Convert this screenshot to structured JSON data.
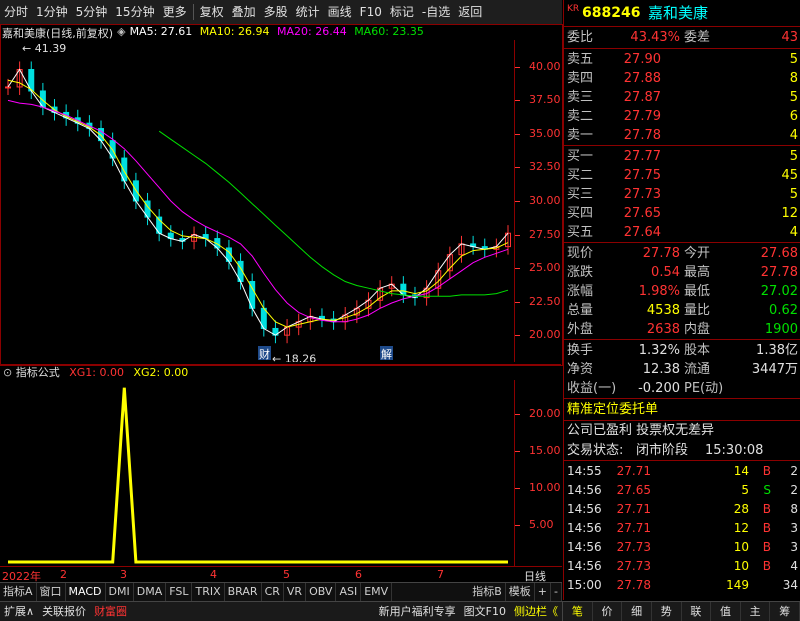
{
  "toolbar": {
    "items": [
      "分时",
      "1分钟",
      "5分钟",
      "15分钟",
      "更多",
      "复权",
      "叠加",
      "多股",
      "统计",
      "画线",
      "F10",
      "标记",
      "-自选",
      "返回"
    ]
  },
  "stock": {
    "market": "KR",
    "code": "688246",
    "name": "嘉和美康"
  },
  "main_chart": {
    "title": "嘉和美康(日线,前复权)",
    "ma": [
      {
        "label": "MA5:",
        "value": "27.61",
        "color": "#ffffff"
      },
      {
        "label": "MA10:",
        "value": "26.94",
        "color": "#ffff00"
      },
      {
        "label": "MA20:",
        "value": "26.44",
        "color": "#ff00ff"
      },
      {
        "label": "MA60:",
        "value": "23.35",
        "color": "#00e000"
      }
    ],
    "price_ticks": [
      "40.00",
      "37.50",
      "35.00",
      "32.50",
      "30.00",
      "27.50",
      "25.00",
      "22.50",
      "20.00"
    ],
    "high_label": "41.39",
    "low_label": "18.26",
    "marker_cai": "财",
    "marker_jie": "解"
  },
  "indicator": {
    "title": "指标公式",
    "xg1_label": "XG1:",
    "xg1_value": "0.00",
    "xg2_label": "XG2:",
    "xg2_value": "0.00",
    "ticks": [
      "20.00",
      "15.00",
      "10.00",
      "5.00"
    ]
  },
  "time_axis": {
    "labels": [
      "2022年",
      "2",
      "3",
      "4",
      "5",
      "6",
      "7"
    ],
    "right_label": "日线"
  },
  "chart_data": {
    "type": "candlestick",
    "ylim": [
      18,
      42
    ],
    "x_months": [
      "2022年",
      "2",
      "3",
      "4",
      "5",
      "6",
      "7"
    ],
    "ma5": [
      38.5,
      39.8,
      38.2,
      37.0,
      36.6,
      36.2,
      35.8,
      35.4,
      34.5,
      33.2,
      31.5,
      30.0,
      28.8,
      27.6,
      27.2,
      27.0,
      27.5,
      27.2,
      26.5,
      25.5,
      24.0,
      22.0,
      20.5,
      20.0,
      20.6,
      21.0,
      21.4,
      21.2,
      21.0,
      21.5,
      22.0,
      22.6,
      23.5,
      23.8,
      23.0,
      22.8,
      23.5,
      24.8,
      26.0,
      26.8,
      26.6,
      26.4,
      26.6,
      27.6
    ],
    "ma10": [
      39.0,
      38.8,
      38.3,
      37.5,
      36.8,
      36.3,
      35.9,
      35.5,
      34.9,
      33.8,
      32.2,
      30.8,
      29.6,
      28.6,
      27.8,
      27.4,
      27.3,
      27.2,
      26.8,
      26.2,
      25.0,
      23.5,
      22.0,
      21.0,
      20.6,
      20.8,
      21.0,
      21.2,
      21.1,
      21.3,
      21.6,
      22.1,
      22.8,
      23.3,
      23.3,
      23.1,
      23.3,
      24.0,
      25.0,
      25.9,
      26.3,
      26.4,
      26.5,
      26.9
    ],
    "ma20": [
      37.5,
      37.3,
      37.2,
      37.0,
      36.7,
      36.4,
      36.0,
      35.6,
      35.2,
      34.6,
      33.9,
      33.0,
      32.0,
      31.0,
      30.0,
      29.2,
      28.6,
      28.1,
      27.7,
      27.3,
      26.8,
      25.9,
      24.6,
      23.4,
      22.4,
      21.7,
      21.3,
      21.1,
      21.0,
      21.0,
      21.2,
      21.5,
      22.0,
      22.4,
      22.7,
      22.9,
      23.1,
      23.6,
      24.2,
      24.8,
      25.4,
      25.8,
      26.1,
      26.4
    ],
    "ma60": [
      null,
      null,
      null,
      null,
      null,
      null,
      null,
      null,
      null,
      null,
      null,
      null,
      null,
      35.2,
      34.6,
      34.0,
      33.4,
      32.8,
      32.1,
      31.4,
      30.6,
      29.8,
      29.0,
      28.2,
      27.4,
      26.6,
      25.8,
      25.1,
      24.5,
      24.0,
      23.7,
      23.5,
      23.3,
      23.1,
      23.0,
      22.9,
      22.9,
      22.9,
      22.9,
      23.0,
      23.0,
      23.0,
      23.1,
      23.35
    ],
    "xg1": [
      0,
      0,
      0,
      0,
      0,
      0,
      0,
      0,
      0,
      0,
      23.5,
      0,
      0,
      0,
      0,
      0,
      0,
      0,
      0,
      0,
      0,
      0,
      0,
      0,
      0,
      0,
      0,
      0,
      0,
      0,
      0,
      0,
      0,
      0,
      0,
      0,
      0,
      0,
      0,
      0,
      0,
      0,
      0,
      0
    ],
    "indicator_ylim": [
      0,
      24
    ]
  },
  "quote": {
    "wb_label": "委比",
    "wb_value": "43.43%",
    "wc_label": "委差",
    "wc_value": "43",
    "asks": [
      {
        "label": "卖五",
        "price": "27.90",
        "vol": "5"
      },
      {
        "label": "卖四",
        "price": "27.88",
        "vol": "8"
      },
      {
        "label": "卖三",
        "price": "27.87",
        "vol": "5"
      },
      {
        "label": "卖二",
        "price": "27.79",
        "vol": "6"
      },
      {
        "label": "卖一",
        "price": "27.78",
        "vol": "4"
      }
    ],
    "bids": [
      {
        "label": "买一",
        "price": "27.77",
        "vol": "5"
      },
      {
        "label": "买二",
        "price": "27.75",
        "vol": "45"
      },
      {
        "label": "买三",
        "price": "27.73",
        "vol": "5"
      },
      {
        "label": "买四",
        "price": "27.65",
        "vol": "12"
      },
      {
        "label": "买五",
        "price": "27.64",
        "vol": "4"
      }
    ],
    "stats": [
      {
        "l1": "现价",
        "v1": "27.78",
        "c1": "red",
        "l2": "今开",
        "v2": "27.68",
        "c2": "red"
      },
      {
        "l1": "涨跌",
        "v1": "0.54",
        "c1": "red",
        "l2": "最高",
        "v2": "27.78",
        "c2": "red"
      },
      {
        "l1": "涨幅",
        "v1": "1.98%",
        "c1": "red",
        "l2": "最低",
        "v2": "27.02",
        "c2": "green"
      },
      {
        "l1": "总量",
        "v1": "4538",
        "c1": "yellow",
        "l2": "量比",
        "v2": "0.62",
        "c2": "green"
      },
      {
        "l1": "外盘",
        "v1": "2638",
        "c1": "red",
        "l2": "内盘",
        "v2": "1900",
        "c2": "green"
      }
    ],
    "stats2": [
      {
        "l1": "换手",
        "v1": "1.32%",
        "l2": "股本",
        "v2": "1.38亿"
      },
      {
        "l1": "净资",
        "v1": "12.38",
        "l2": "流通",
        "v2": "3447万"
      },
      {
        "l1": "收益(一)",
        "v1": "-0.200",
        "l2": "PE(动)",
        "v2": ""
      }
    ],
    "notice": "精准定位委托单",
    "line1": "公司已盈利 投票权无差异",
    "trade_status_label": "交易状态:",
    "trade_status": "闭市阶段",
    "trade_time": "15:30:08"
  },
  "ticks_list": [
    {
      "time": "14:55",
      "price": "27.71",
      "vol": "14",
      "bs": "B",
      "n": "2"
    },
    {
      "time": "14:56",
      "price": "27.65",
      "vol": "5",
      "bs": "S",
      "n": "2"
    },
    {
      "time": "14:56",
      "price": "27.71",
      "vol": "28",
      "bs": "B",
      "n": "8"
    },
    {
      "time": "14:56",
      "price": "27.71",
      "vol": "12",
      "bs": "B",
      "n": "3"
    },
    {
      "time": "14:56",
      "price": "27.73",
      "vol": "10",
      "bs": "B",
      "n": "3"
    },
    {
      "time": "14:56",
      "price": "27.73",
      "vol": "10",
      "bs": "B",
      "n": "4"
    },
    {
      "time": "15:00",
      "price": "27.78",
      "vol": "149",
      "bs": "",
      "n": "34"
    }
  ],
  "indicator_tabs": [
    "指标A",
    "窗口",
    "MACD",
    "DMI",
    "DMA",
    "FSL",
    "TRIX",
    "BRAR",
    "CR",
    "VR",
    "OBV",
    "ASI",
    "EMV",
    "指标B",
    "模板",
    "+",
    "-"
  ],
  "status_bar": {
    "left": [
      "扩展∧",
      "关联报价",
      "财富圈"
    ],
    "right": [
      "新用户福利专享",
      "图文F10",
      "侧边栏《"
    ]
  },
  "right_tabs": [
    "笔",
    "价",
    "细",
    "势",
    "联",
    "值",
    "主",
    "筹"
  ]
}
